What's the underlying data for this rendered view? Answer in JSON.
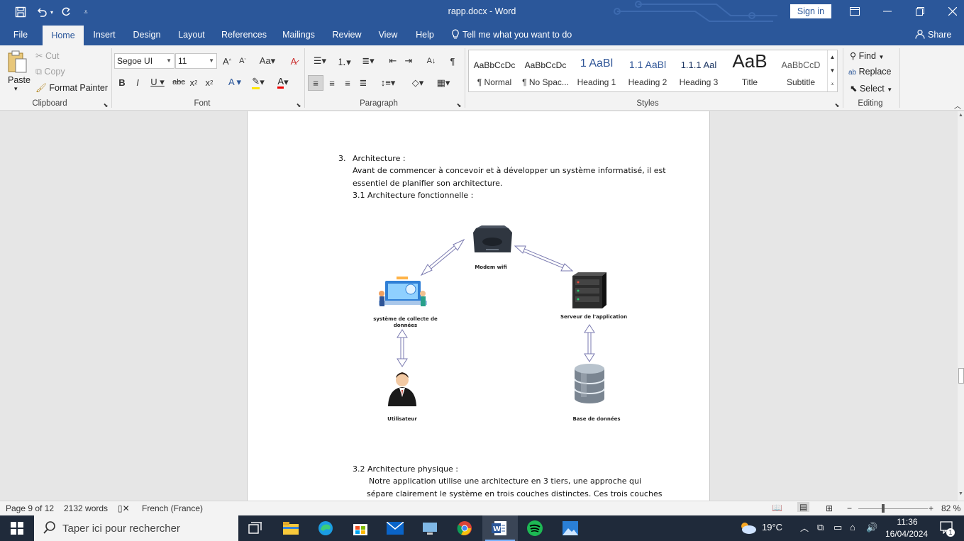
{
  "window": {
    "title": "rapp.docx - Word",
    "sign_in": "Sign in"
  },
  "menu": {
    "tabs": [
      "File",
      "Home",
      "Insert",
      "Design",
      "Layout",
      "References",
      "Mailings",
      "Review",
      "View",
      "Help"
    ],
    "active_tab": "Home",
    "tell_me": "Tell me what you want to do",
    "share": "Share"
  },
  "ribbon": {
    "clipboard": {
      "label": "Clipboard",
      "paste": "Paste",
      "cut": "Cut",
      "copy": "Copy",
      "format_painter": "Format Painter"
    },
    "font": {
      "label": "Font",
      "font_name": "Segoe UI",
      "font_size": "11"
    },
    "paragraph": {
      "label": "Paragraph"
    },
    "styles": {
      "label": "Styles",
      "items": [
        {
          "sample": "AaBbCcDc",
          "name": "¶ Normal"
        },
        {
          "sample": "AaBbCcDc",
          "name": "¶ No Spac..."
        },
        {
          "sample": "1 AaBl",
          "name": "Heading 1"
        },
        {
          "sample": "1.1 AaBl",
          "name": "Heading 2"
        },
        {
          "sample": "1.1.1 Aal",
          "name": "Heading 3"
        },
        {
          "sample": "AaB",
          "name": "Title"
        },
        {
          "sample": "AaBbCcD",
          "name": "Subtitle"
        }
      ]
    },
    "editing": {
      "label": "Editing",
      "find": "Find",
      "replace": "Replace",
      "select": "Select"
    }
  },
  "document": {
    "heading_num": "3.",
    "heading": "Architecture :",
    "para1_line1": "Avant de commencer à concevoir et à développer un système informatisé, il est",
    "para1_line2": "essentiel de planifier son architecture.",
    "sub1": "3.1  Architecture fonctionnelle :",
    "diagram": {
      "modem": "Modem wifi",
      "collect_line1": "système de collecte de",
      "collect_line2": "données",
      "server": "Serveur de l'application",
      "user": "Utilisateur",
      "db": "Base de données"
    },
    "sub2": "3.2  Architecture physique :",
    "para2_line1": "Notre application utilise une architecture en 3 tiers, une approche qui",
    "para2_line2": "sépare clairement le système en trois couches distinctes. Ces trois couches"
  },
  "status": {
    "page": "Page 9 of 12",
    "words": "2132 words",
    "language": "French (France)",
    "zoom": "82 %"
  },
  "taskbar": {
    "search_placeholder": "Taper ici pour rechercher",
    "weather": "19°C",
    "time": "11:36",
    "date": "16/04/2024",
    "notification_count": "1"
  },
  "colors": {
    "word_blue": "#2b579a",
    "ribbon_bg": "#f3f3f3",
    "taskbar_bg": "#1f2a3a"
  }
}
